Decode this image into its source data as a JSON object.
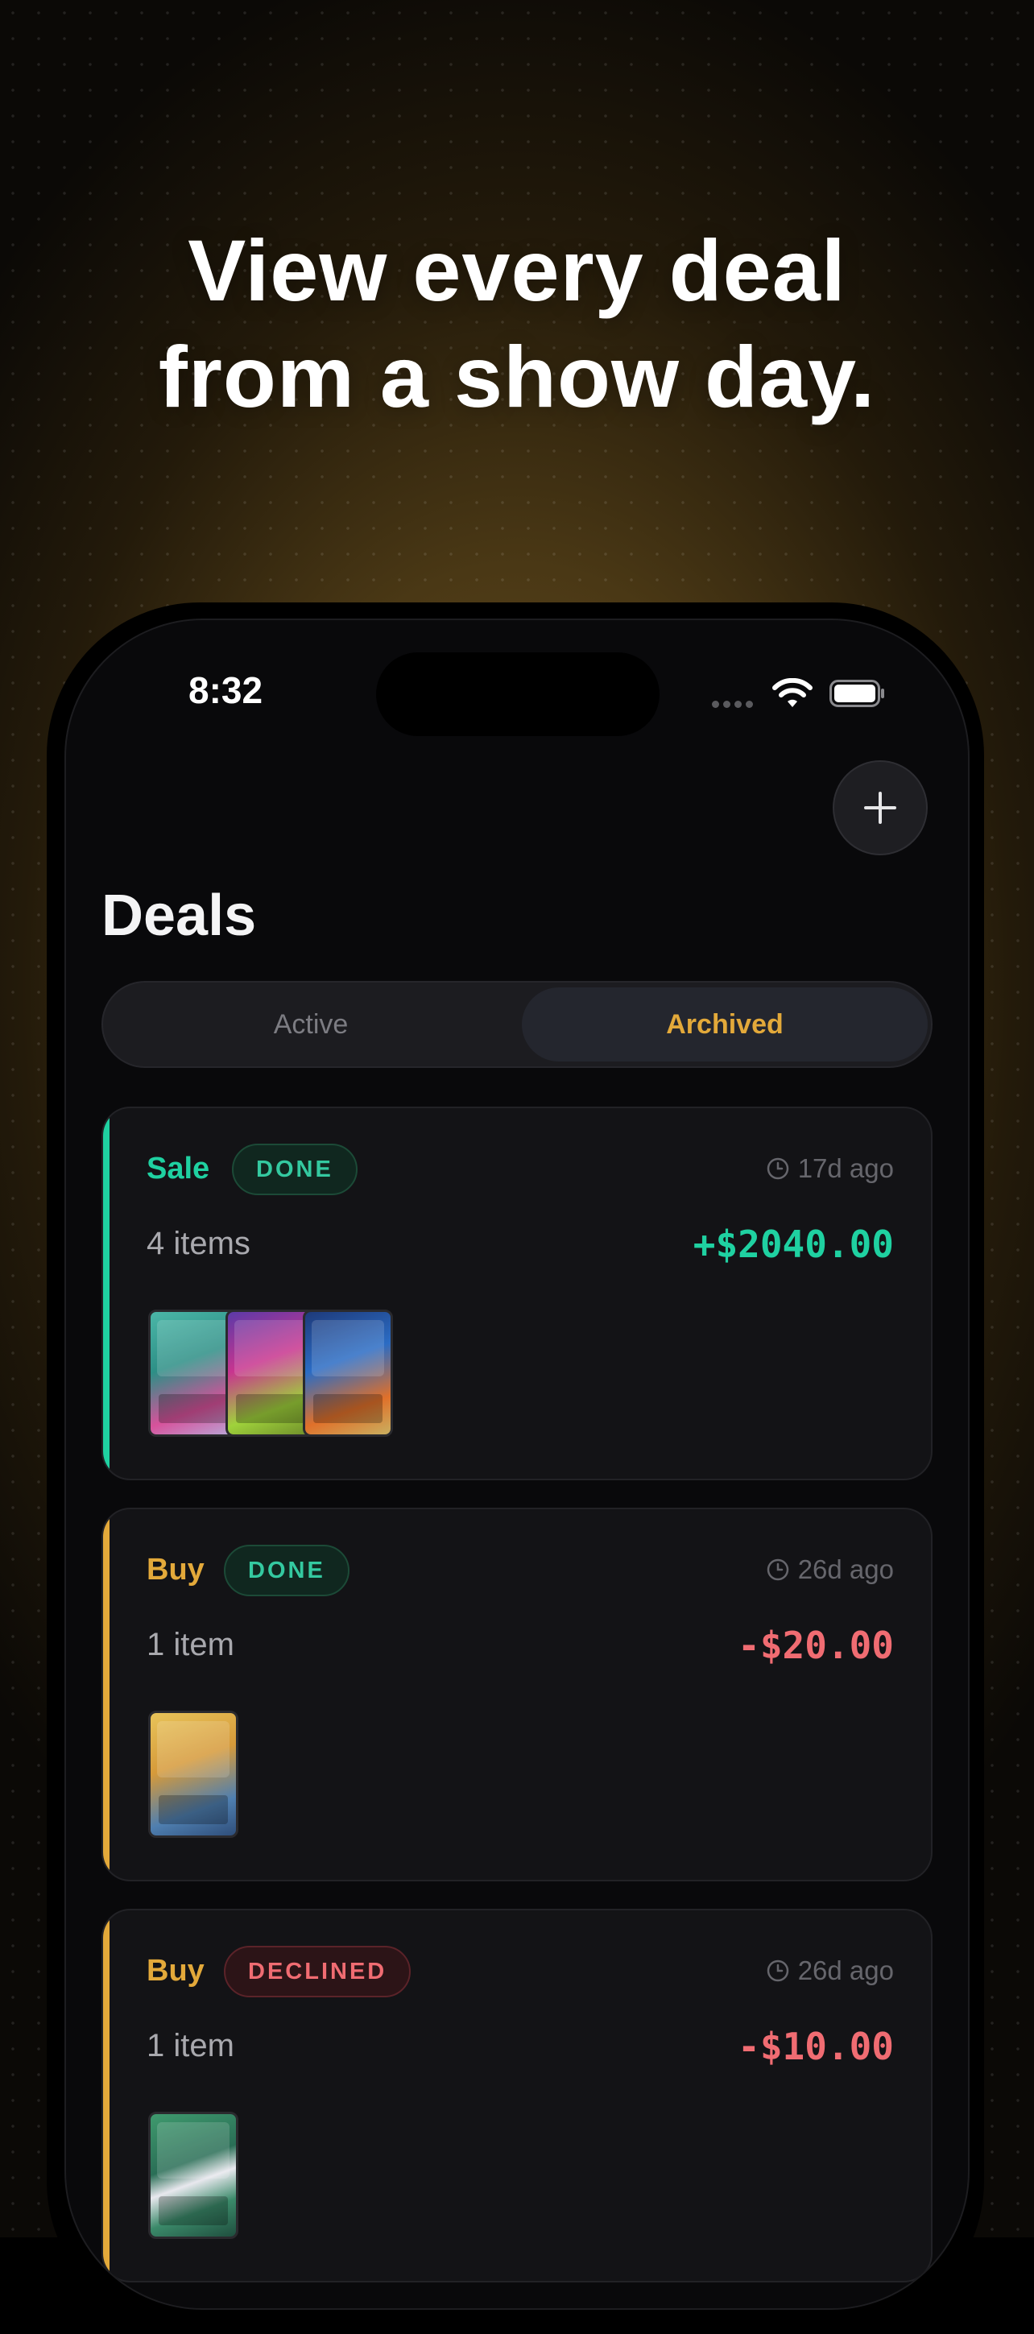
{
  "headline": {
    "line1": "View every deal",
    "line2": "from a show day."
  },
  "status_bar": {
    "time": "8:32"
  },
  "screen": {
    "title": "Deals",
    "tabs": [
      {
        "label": "Active",
        "selected": false
      },
      {
        "label": "Archived",
        "selected": true
      }
    ]
  },
  "deals": [
    {
      "type": "Sale",
      "status": "DONE",
      "ago": "17d ago",
      "items": "4 items",
      "amount": "+$2040.00",
      "thumb_count": 3
    },
    {
      "type": "Buy",
      "status": "DONE",
      "ago": "26d ago",
      "items": "1 item",
      "amount": "-$20.00",
      "thumb_count": 1
    },
    {
      "type": "Buy",
      "status": "DECLINED",
      "ago": "26d ago",
      "items": "1 item",
      "amount": "-$10.00",
      "thumb_count": 1
    }
  ],
  "colors": {
    "sale_accent": "#1fd1a1",
    "buy_accent": "#e3a93a",
    "positive_amount": "#1fd1a1",
    "negative_amount": "#f06c72",
    "tab_active_text": "#e3a93a"
  },
  "icons": [
    "plus-icon",
    "clock-icon",
    "wifi-icon",
    "battery-icon",
    "signal-icon"
  ]
}
